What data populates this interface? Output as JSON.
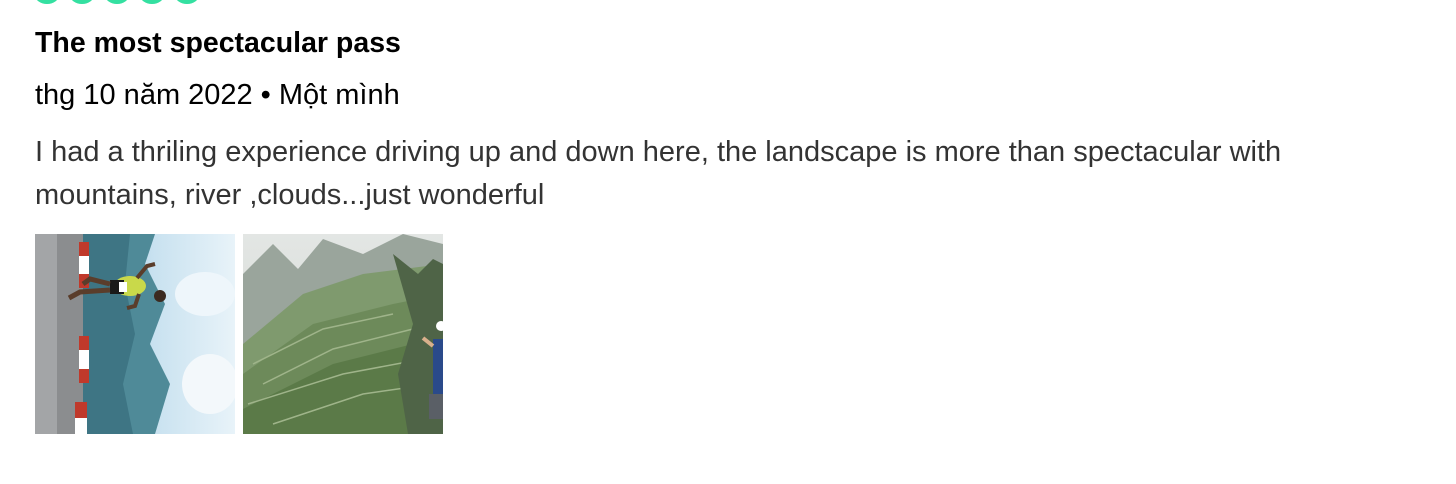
{
  "review": {
    "rating_bubbles": 5,
    "rating_color": "#34e0a1",
    "title": "The most spectacular pass",
    "date": "thg 10 năm 2022",
    "separator": "•",
    "trip_type": "Một mình",
    "body": "I had a thriling experience driving up and down here, the landscape is more than spectacular with mountains, river ,clouds...just wonderful",
    "photos": [
      {
        "name": "photo-runner-on-pass",
        "description_icon": "runner-mountain-road"
      },
      {
        "name": "photo-valley-terraces",
        "description_icon": "valley-terraced-fields"
      }
    ]
  }
}
